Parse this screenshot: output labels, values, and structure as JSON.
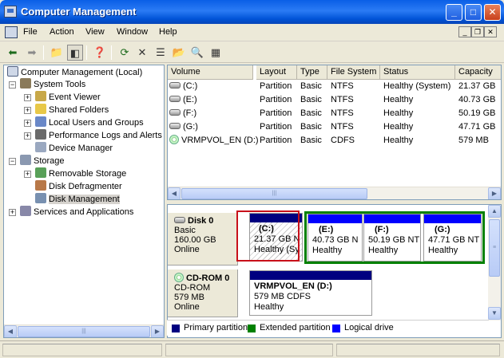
{
  "window": {
    "title": "Computer Management"
  },
  "menu": [
    "File",
    "Action",
    "View",
    "Window",
    "Help"
  ],
  "tree": {
    "root": "Computer Management (Local)",
    "system_tools": "System Tools",
    "event_viewer": "Event Viewer",
    "shared_folders": "Shared Folders",
    "local_users": "Local Users and Groups",
    "perf_logs": "Performance Logs and Alerts",
    "device_manager": "Device Manager",
    "storage": "Storage",
    "removable_storage": "Removable Storage",
    "disk_defrag": "Disk Defragmenter",
    "disk_management": "Disk Management",
    "services_apps": "Services and Applications"
  },
  "volumes": {
    "columns": [
      "Volume",
      "Layout",
      "Type",
      "File System",
      "Status",
      "Capacity"
    ],
    "rows": [
      {
        "volume": "(C:)",
        "layout": "Partition",
        "type": "Basic",
        "fs": "NTFS",
        "status": "Healthy (System)",
        "capacity": "21.37 GB"
      },
      {
        "volume": "(E:)",
        "layout": "Partition",
        "type": "Basic",
        "fs": "NTFS",
        "status": "Healthy",
        "capacity": "40.73 GB"
      },
      {
        "volume": "(F:)",
        "layout": "Partition",
        "type": "Basic",
        "fs": "NTFS",
        "status": "Healthy",
        "capacity": "50.19 GB"
      },
      {
        "volume": "(G:)",
        "layout": "Partition",
        "type": "Basic",
        "fs": "NTFS",
        "status": "Healthy",
        "capacity": "47.71 GB"
      },
      {
        "volume": "VRMPVOL_EN (D:)",
        "layout": "Partition",
        "type": "Basic",
        "fs": "CDFS",
        "status": "Healthy",
        "capacity": "579 MB"
      }
    ]
  },
  "disks": {
    "disk0": {
      "name": "Disk 0",
      "type": "Basic",
      "size": "160.00 GB",
      "state": "Online"
    },
    "cdrom0": {
      "name": "CD-ROM 0",
      "type": "CD-ROM",
      "size": "579 MB",
      "state": "Online"
    }
  },
  "partitions": {
    "c": {
      "name": "(C:)",
      "size": "21.37 GB N",
      "status": "Healthy (Sy"
    },
    "e": {
      "name": "(E:)",
      "size": "40.73 GB N",
      "status": "Healthy"
    },
    "f": {
      "name": "(F:)",
      "size": "50.19 GB NT",
      "status": "Healthy"
    },
    "g": {
      "name": "(G:)",
      "size": "47.71 GB NT",
      "status": "Healthy"
    },
    "d": {
      "name": "VRMPVOL_EN  (D:)",
      "size": "579 MB CDFS",
      "status": "Healthy"
    }
  },
  "legend": [
    "Primary partition",
    "Extended partition",
    "Logical drive"
  ],
  "colors": {
    "primary": "#000080",
    "extended": "#008000",
    "logical": "#0000ff",
    "highlight": "#c8101a"
  }
}
